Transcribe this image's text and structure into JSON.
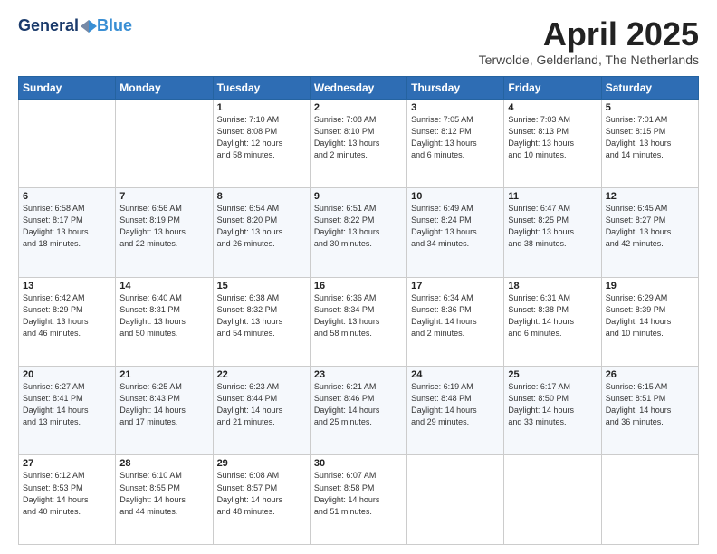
{
  "header": {
    "logo_general": "General",
    "logo_blue": "Blue",
    "month_title": "April 2025",
    "location": "Terwolde, Gelderland, The Netherlands"
  },
  "days_of_week": [
    "Sunday",
    "Monday",
    "Tuesday",
    "Wednesday",
    "Thursday",
    "Friday",
    "Saturday"
  ],
  "weeks": [
    [
      {
        "day": "",
        "info": ""
      },
      {
        "day": "",
        "info": ""
      },
      {
        "day": "1",
        "info": "Sunrise: 7:10 AM\nSunset: 8:08 PM\nDaylight: 12 hours\nand 58 minutes."
      },
      {
        "day": "2",
        "info": "Sunrise: 7:08 AM\nSunset: 8:10 PM\nDaylight: 13 hours\nand 2 minutes."
      },
      {
        "day": "3",
        "info": "Sunrise: 7:05 AM\nSunset: 8:12 PM\nDaylight: 13 hours\nand 6 minutes."
      },
      {
        "day": "4",
        "info": "Sunrise: 7:03 AM\nSunset: 8:13 PM\nDaylight: 13 hours\nand 10 minutes."
      },
      {
        "day": "5",
        "info": "Sunrise: 7:01 AM\nSunset: 8:15 PM\nDaylight: 13 hours\nand 14 minutes."
      }
    ],
    [
      {
        "day": "6",
        "info": "Sunrise: 6:58 AM\nSunset: 8:17 PM\nDaylight: 13 hours\nand 18 minutes."
      },
      {
        "day": "7",
        "info": "Sunrise: 6:56 AM\nSunset: 8:19 PM\nDaylight: 13 hours\nand 22 minutes."
      },
      {
        "day": "8",
        "info": "Sunrise: 6:54 AM\nSunset: 8:20 PM\nDaylight: 13 hours\nand 26 minutes."
      },
      {
        "day": "9",
        "info": "Sunrise: 6:51 AM\nSunset: 8:22 PM\nDaylight: 13 hours\nand 30 minutes."
      },
      {
        "day": "10",
        "info": "Sunrise: 6:49 AM\nSunset: 8:24 PM\nDaylight: 13 hours\nand 34 minutes."
      },
      {
        "day": "11",
        "info": "Sunrise: 6:47 AM\nSunset: 8:25 PM\nDaylight: 13 hours\nand 38 minutes."
      },
      {
        "day": "12",
        "info": "Sunrise: 6:45 AM\nSunset: 8:27 PM\nDaylight: 13 hours\nand 42 minutes."
      }
    ],
    [
      {
        "day": "13",
        "info": "Sunrise: 6:42 AM\nSunset: 8:29 PM\nDaylight: 13 hours\nand 46 minutes."
      },
      {
        "day": "14",
        "info": "Sunrise: 6:40 AM\nSunset: 8:31 PM\nDaylight: 13 hours\nand 50 minutes."
      },
      {
        "day": "15",
        "info": "Sunrise: 6:38 AM\nSunset: 8:32 PM\nDaylight: 13 hours\nand 54 minutes."
      },
      {
        "day": "16",
        "info": "Sunrise: 6:36 AM\nSunset: 8:34 PM\nDaylight: 13 hours\nand 58 minutes."
      },
      {
        "day": "17",
        "info": "Sunrise: 6:34 AM\nSunset: 8:36 PM\nDaylight: 14 hours\nand 2 minutes."
      },
      {
        "day": "18",
        "info": "Sunrise: 6:31 AM\nSunset: 8:38 PM\nDaylight: 14 hours\nand 6 minutes."
      },
      {
        "day": "19",
        "info": "Sunrise: 6:29 AM\nSunset: 8:39 PM\nDaylight: 14 hours\nand 10 minutes."
      }
    ],
    [
      {
        "day": "20",
        "info": "Sunrise: 6:27 AM\nSunset: 8:41 PM\nDaylight: 14 hours\nand 13 minutes."
      },
      {
        "day": "21",
        "info": "Sunrise: 6:25 AM\nSunset: 8:43 PM\nDaylight: 14 hours\nand 17 minutes."
      },
      {
        "day": "22",
        "info": "Sunrise: 6:23 AM\nSunset: 8:44 PM\nDaylight: 14 hours\nand 21 minutes."
      },
      {
        "day": "23",
        "info": "Sunrise: 6:21 AM\nSunset: 8:46 PM\nDaylight: 14 hours\nand 25 minutes."
      },
      {
        "day": "24",
        "info": "Sunrise: 6:19 AM\nSunset: 8:48 PM\nDaylight: 14 hours\nand 29 minutes."
      },
      {
        "day": "25",
        "info": "Sunrise: 6:17 AM\nSunset: 8:50 PM\nDaylight: 14 hours\nand 33 minutes."
      },
      {
        "day": "26",
        "info": "Sunrise: 6:15 AM\nSunset: 8:51 PM\nDaylight: 14 hours\nand 36 minutes."
      }
    ],
    [
      {
        "day": "27",
        "info": "Sunrise: 6:12 AM\nSunset: 8:53 PM\nDaylight: 14 hours\nand 40 minutes."
      },
      {
        "day": "28",
        "info": "Sunrise: 6:10 AM\nSunset: 8:55 PM\nDaylight: 14 hours\nand 44 minutes."
      },
      {
        "day": "29",
        "info": "Sunrise: 6:08 AM\nSunset: 8:57 PM\nDaylight: 14 hours\nand 48 minutes."
      },
      {
        "day": "30",
        "info": "Sunrise: 6:07 AM\nSunset: 8:58 PM\nDaylight: 14 hours\nand 51 minutes."
      },
      {
        "day": "",
        "info": ""
      },
      {
        "day": "",
        "info": ""
      },
      {
        "day": "",
        "info": ""
      }
    ]
  ]
}
